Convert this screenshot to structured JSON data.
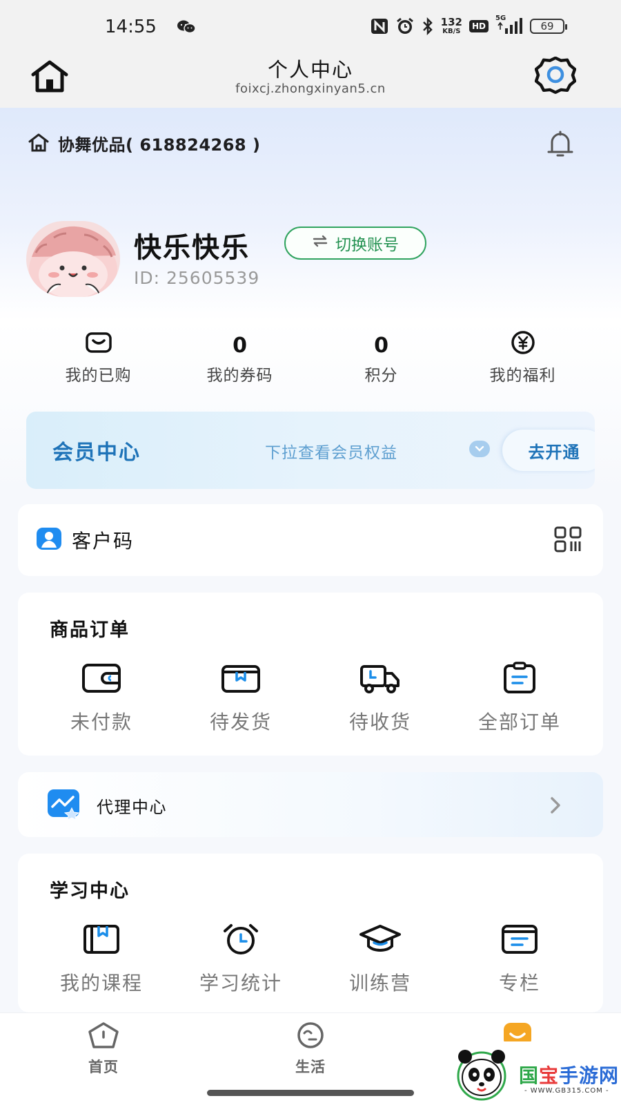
{
  "status_bar": {
    "time": "14:55",
    "network_speed_value": "132",
    "network_speed_unit": "KB/S",
    "hd_label": "HD",
    "signal_label": "5G",
    "battery": "69",
    "icons": [
      "wechat-icon",
      "nfc-icon",
      "alarm-icon",
      "bluetooth-icon",
      "signal-icon",
      "battery-icon"
    ]
  },
  "header": {
    "title": "个人中心",
    "url": "foixcj.zhongxinyan5.cn",
    "icons": [
      "home-icon",
      "settings-icon"
    ]
  },
  "shop": {
    "name": "协舞优品( 618824268 )",
    "icons": [
      "shop-home-icon",
      "bell-icon"
    ]
  },
  "profile": {
    "username": "快乐快乐",
    "switch_label": "切换账号",
    "user_id": "ID: 25605539"
  },
  "stats": [
    {
      "value": "",
      "icon": "purchased-bag-icon",
      "label": "我的已购"
    },
    {
      "value": "0",
      "icon": "",
      "label": "我的券码"
    },
    {
      "value": "0",
      "icon": "",
      "label": "积分"
    },
    {
      "value": "",
      "icon": "yuan-coin-icon",
      "label": "我的福利"
    }
  ],
  "membership": {
    "title": "会员中心",
    "hint": "下拉查看会员权益",
    "action": "去开通"
  },
  "customer_code": {
    "label": "客户码",
    "icons": [
      "customer-code-icon",
      "qr-code-icon"
    ]
  },
  "orders": {
    "title": "商品订单",
    "items": [
      {
        "label": "未付款",
        "icon": "wallet-icon"
      },
      {
        "label": "待发货",
        "icon": "box-icon"
      },
      {
        "label": "待收货",
        "icon": "truck-icon"
      },
      {
        "label": "全部订单",
        "icon": "clipboard-icon"
      }
    ]
  },
  "agent": {
    "label": "代理中心",
    "icons": [
      "agent-chart-icon",
      "chevron-right-icon"
    ]
  },
  "study": {
    "title": "学习中心",
    "items": [
      {
        "label": "我的课程",
        "icon": "course-book-icon"
      },
      {
        "label": "学习统计",
        "icon": "alarm-clock-icon"
      },
      {
        "label": "训练营",
        "icon": "graduation-cap-icon"
      },
      {
        "label": "专栏",
        "icon": "column-card-icon"
      }
    ]
  },
  "tabbar": {
    "items": [
      {
        "label": "首页",
        "icon": "home-pentagon-icon"
      },
      {
        "label": "生活",
        "icon": "life-circle-icon"
      },
      {
        "label": "",
        "icon": "profile-tab-icon"
      }
    ]
  },
  "watermark": {
    "text_part1": "国",
    "text_part2": "宝",
    "text_part3": "手游网",
    "url": "- WWW.GB315.COM -"
  },
  "colors": {
    "accent_green": "#2fa35e",
    "member_blue": "#1e73b8",
    "active_tab_orange": "#f5a623"
  }
}
